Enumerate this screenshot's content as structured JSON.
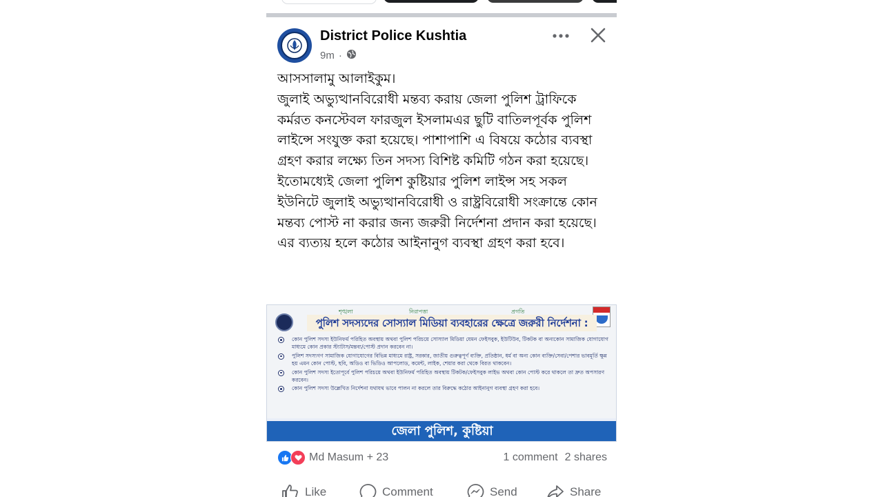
{
  "post": {
    "page_name": "District Police Kushtia",
    "time": "9m",
    "separator": "·",
    "privacy_icon": "globe-icon",
    "more_icon": "more-dots-icon",
    "close_icon": "close-icon",
    "text_lines": [
      "আসসালামু আলাইকুম।",
      "জুলাই অভ্যুত্থানবিরোধী মন্তব্য করায় জেলা পুলিশ ট্রাফিকে কর্মরত কনস্টেবল ফারজুল ইসলামএর ছুটি বাতিলপূর্বক পুলিশ লাইন্সে সংযুক্ত করা হয়েছে। পাশাপাশি এ বিষয়ে কঠোর ব্যবস্থা গ্রহণ করার লক্ষ্যে তিন সদস্য বিশিষ্ট কমিটি গঠন করা হয়েছে।",
      "ইতোমধ্যেই জেলা পুলিশ কুষ্টিয়ার পুলিশ লাইন্স সহ সকল ইউনিটে জুলাই অভ্যুত্থানবিরোধী ও রাষ্ট্রবিরোধী সংক্রান্তে কোন  মন্তব্য পোস্ট না করার জন্য  জরুরী নির্দেশনা প্রদান করা হয়েছে।",
      "এর ব্যত্যয় হলে কঠোর আইনানুগ ব্যবস্থা গ্রহণ করা হবে।"
    ]
  },
  "banner": {
    "motto": [
      "শৃঙ্খলা",
      "নিরাপত্তা",
      "প্রগতি"
    ],
    "heading": "পুলিশ সদস্যদের সোস্যাল মিডিয়া ব্যবহারের ক্ষেত্রে জরুরী নির্দেশনা :",
    "items": [
      "কোন পুলিশ সদস্য ইউনিফর্ম পরিহিত অবস্থায় অথবা পুলিশ পরিচয়ে সোস্যাল মিডিয়া যেমন ফেইসবুক, ইউটিউব, টিকটক বা অন্যকোন সামাজিক যোগাযোগ মাধ্যমে কোন প্রকার স্ট্যাটাস/মন্তব্য/পোস্ট প্রদান করবেন না।",
      "পুলিশ সদস্যগণ সামাজিক যোগাযোগের বিভিন্ন মাধ্যমে রাষ্ট্র, সরকার, জাতীয় গুরুত্বপূর্ণ ব্যক্তি, প্রতিষ্ঠান, ধর্ম বা অন্য কোন ব্যক্তি/সেবা/পেশার ভাবমূর্তি ক্ষুন্ন হয় এমন কোন পোস্ট, ছবি, অডিও বা ভিডিও আপলোড, কমেন্ট, লাইক, শেয়ার করা থেকে বিরত থাকবেন।",
      "কোন পুলিশ সদস্য ইতোপূর্বে পুলিশ পরিচয়ে অথবা ইউনিফর্ম পরিহিত অবস্থায় টিকটক/ফেইসবুক লাইভ অথবা কোন পোস্ট করে থাকলে তা দ্রুত অপসারণ করবেন।",
      "কোন পুলিশ সদস্য উল্লেখিত নির্দেশনা যথাযথ ভাবে পালন না করলে তার বিরুদ্ধে কঠোর আইনানুগ ব্যবস্থা গ্রহণ করা হবে।"
    ],
    "footer": "জেলা পুলিশ, কুষ্টিয়া"
  },
  "reactions": {
    "names": "Md Masum + 23",
    "comments": "1 comment",
    "shares": "2 shares",
    "icons": [
      "like-reaction-icon",
      "love-reaction-icon"
    ]
  },
  "actions": {
    "like": "Like",
    "comment": "Comment",
    "send": "Send",
    "share": "Share"
  },
  "colors": {
    "facebook_blue": "#1877f2",
    "love_red": "#f33e58",
    "meta_gray": "#65676b",
    "banner_blue": "#1f63b8"
  }
}
